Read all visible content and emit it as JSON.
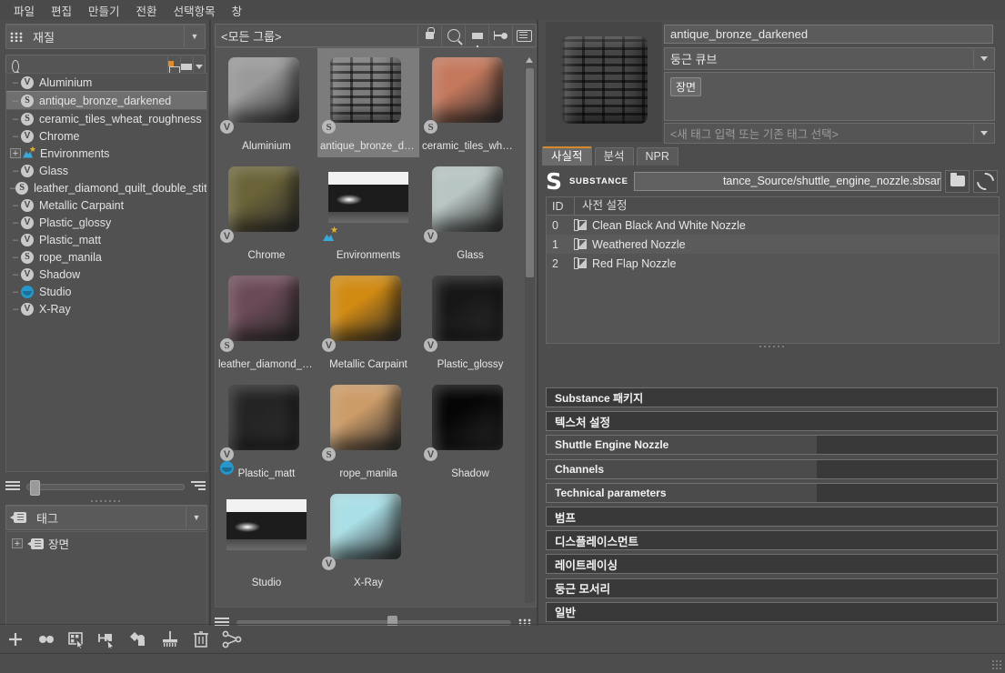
{
  "menu": {
    "items": [
      "파일",
      "편집",
      "만들기",
      "전환",
      "선택항목",
      "창"
    ]
  },
  "left_panel": {
    "mode_selector": {
      "label": "재질",
      "icon": "grid-icon"
    },
    "search": {
      "value": "",
      "placeholder": ""
    },
    "tree_items": [
      {
        "label": "Aluminium",
        "badge": "V",
        "expandable": false
      },
      {
        "label": "antique_bronze_darkened",
        "badge": "S",
        "expandable": false,
        "selected": true
      },
      {
        "label": "ceramic_tiles_wheat_roughness",
        "badge": "S",
        "expandable": false
      },
      {
        "label": "Chrome",
        "badge": "V",
        "expandable": false
      },
      {
        "label": "Environments",
        "badge": "ENV",
        "expandable": true
      },
      {
        "label": "Glass",
        "badge": "V",
        "expandable": false
      },
      {
        "label": "leather_diamond_quilt_double_stitch",
        "badge": "S",
        "expandable": false
      },
      {
        "label": "Metallic Carpaint",
        "badge": "V",
        "expandable": false
      },
      {
        "label": "Plastic_glossy",
        "badge": "V",
        "expandable": false
      },
      {
        "label": "Plastic_matt",
        "badge": "V",
        "expandable": false
      },
      {
        "label": "rope_manila",
        "badge": "S",
        "expandable": false
      },
      {
        "label": "Shadow",
        "badge": "V",
        "expandable": false
      },
      {
        "label": "Studio",
        "badge": "STUDIO",
        "expandable": false
      },
      {
        "label": "X-Ray",
        "badge": "V",
        "expandable": false
      }
    ],
    "tag_selector": {
      "label": "태그"
    },
    "tag_tree": [
      {
        "label": "장면",
        "expandable": true
      }
    ]
  },
  "center_panel": {
    "group_filter": "<모든 그룹>",
    "toolbar_icons": [
      "lock-icon",
      "search-icon",
      "filter-icon",
      "layout-icon",
      "list-icon"
    ],
    "items": [
      {
        "label": "Aluminium",
        "badge": "V",
        "type": "cube",
        "color": "#9a9a9a"
      },
      {
        "label": "antique_bronze_dark...",
        "badge": "S",
        "type": "cube",
        "color": "#b3252a",
        "selected": true
      },
      {
        "label": "ceramic_tiles_wheat_r...",
        "badge": "S",
        "type": "cube",
        "color": "#c4785c"
      },
      {
        "label": "Chrome",
        "badge": "V",
        "type": "cube",
        "color": "#6a6338"
      },
      {
        "label": "Environments",
        "badge": "ENV",
        "type": "env"
      },
      {
        "label": "Glass",
        "badge": "V",
        "type": "cube",
        "color": "#b8c6c3"
      },
      {
        "label": "leather_diamond_quil...",
        "badge": "S",
        "type": "cube",
        "color": "#6b4a57"
      },
      {
        "label": "Metallic Carpaint",
        "badge": "V",
        "type": "cube",
        "color": "#d18a12"
      },
      {
        "label": "Plastic_glossy",
        "badge": "V",
        "type": "cube",
        "color": "#171717"
      },
      {
        "label": "Plastic_matt",
        "badge": "V",
        "type": "cube",
        "color": "#242424"
      },
      {
        "label": "rope_manila",
        "badge": "S",
        "type": "cube",
        "color": "#cc9c68"
      },
      {
        "label": "Shadow",
        "badge": "V",
        "type": "cube",
        "color": "#050505"
      },
      {
        "label": "Studio",
        "badge": "STUDIO",
        "type": "env"
      },
      {
        "label": "X-Ray",
        "badge": "V",
        "type": "cube",
        "color": "#a9dfe6"
      }
    ]
  },
  "right_panel": {
    "material_name": "antique_bronze_darkened",
    "shape_selector": "둥근 큐브",
    "tags": [
      "장면"
    ],
    "tag_input_placeholder": "<새 태그 입력 또는 기존 태그 선택>",
    "tabs": [
      {
        "label": "사실적",
        "active": true
      },
      {
        "label": "분석",
        "active": false
      },
      {
        "label": "NPR",
        "active": false
      }
    ],
    "substance": {
      "logo_text": "SUBSTANCE",
      "path": "tance_Source/shuttle_engine_nozzle.sbsar",
      "open_icon": "folder-icon",
      "reload_icon": "refresh-icon",
      "table": {
        "headers": [
          "ID",
          "사전 설정"
        ],
        "rows": [
          {
            "id": "0",
            "name": "Clean Black And White Nozzle"
          },
          {
            "id": "1",
            "name": "Weathered Nozzle"
          },
          {
            "id": "2",
            "name": "Red Flap Nozzle"
          }
        ]
      }
    },
    "sections": [
      {
        "label": "Substance 패키지",
        "bold_latin": true,
        "fill": 0
      },
      {
        "label": "텍스처 설정",
        "bold_latin": false,
        "fill": 0
      },
      {
        "label": "Shuttle Engine Nozzle",
        "bold_latin": true,
        "fill": 60
      },
      {
        "label": "Channels",
        "bold_latin": true,
        "fill": 60
      },
      {
        "label": "Technical parameters",
        "bold_latin": true,
        "fill": 60
      },
      {
        "label": "범프",
        "bold_latin": false,
        "fill": 0
      },
      {
        "label": "디스플레이스먼트",
        "bold_latin": false,
        "fill": 0
      },
      {
        "label": "레이트레이싱",
        "bold_latin": false,
        "fill": 0
      },
      {
        "label": "둥근 모서리",
        "bold_latin": false,
        "fill": 0
      },
      {
        "label": "일반",
        "bold_latin": false,
        "fill": 0
      }
    ]
  },
  "bottom_toolbar": {
    "buttons": [
      "add-icon",
      "two-dots-icon",
      "select-grid-icon",
      "select-tag-icon",
      "select-objects-icon",
      "cleanup-icon",
      "delete-icon",
      "node-graph-icon"
    ]
  },
  "colors": {
    "accent": "#d88a2a",
    "panel_bg": "#4d4d4d",
    "field_bg": "#5a5a5a",
    "section_bg": "#393939",
    "selection": "#6f6f6f"
  }
}
